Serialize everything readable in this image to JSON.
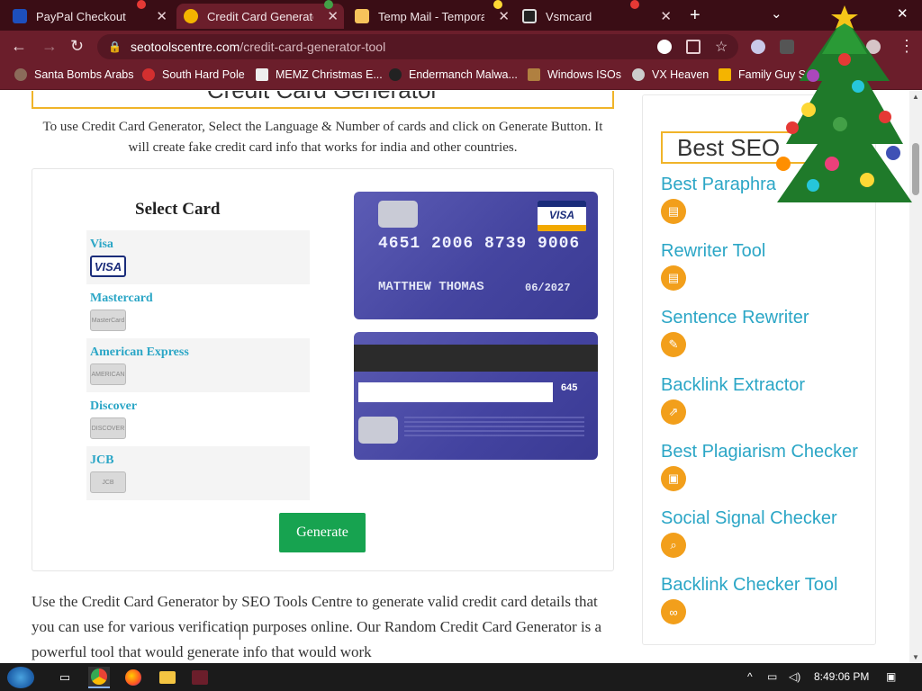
{
  "tabs": [
    {
      "label": "PayPal Checkout",
      "icon": "paypal-icon",
      "active": false
    },
    {
      "label": "Credit Card Generator",
      "icon": "seotools-icon",
      "active": true
    },
    {
      "label": "Temp Mail - Temporary",
      "icon": "mail-icon",
      "active": false
    },
    {
      "label": "Vsmcard",
      "icon": "card-icon",
      "active": false
    }
  ],
  "toolbar": {
    "url_domain": "seotoolscentre.com",
    "url_path": "/credit-card-generator-tool"
  },
  "bookmarks": [
    {
      "label": "Santa Bombs Arabs"
    },
    {
      "label": "South Hard Pole"
    },
    {
      "label": "MEMZ Christmas E..."
    },
    {
      "label": "Endermanch Malwa..."
    },
    {
      "label": "Windows ISOs"
    },
    {
      "label": "VX Heaven"
    },
    {
      "label": "Family Guy S..."
    }
  ],
  "main": {
    "heading": "Credit Card Generator",
    "intro": "To use Credit Card Generator, Select the Language & Number of cards and click on Generate Button. It will create fake credit card info that works for india and other countries.",
    "select_title": "Select Card",
    "card_options": [
      {
        "label": "Visa",
        "logo": "VISA"
      },
      {
        "label": "Mastercard",
        "logo": "MasterCard"
      },
      {
        "label": "American Express",
        "logo": "AMERICAN"
      },
      {
        "label": "Discover",
        "logo": "DISCOVER"
      },
      {
        "label": "JCB",
        "logo": "JCB"
      }
    ],
    "card_front": {
      "number": "4651 2006 8739 9006",
      "name": "MATTHEW THOMAS",
      "expiry": "06/2027",
      "brand": "VISA"
    },
    "card_back": {
      "cvv": "645"
    },
    "generate_label": "Generate",
    "description": "Use the Credit Card Generator by SEO Tools Centre to generate valid credit card details that you can use for various verification purposes online. Our Random Credit Card Generator is a powerful tool that would generate info that would work"
  },
  "sidebar": {
    "title": "Best SEO",
    "tools": [
      {
        "name": "Best Paraphra",
        "icon": "document-icon"
      },
      {
        "name": "Rewriter Tool",
        "icon": "document-icon"
      },
      {
        "name": "Sentence Rewriter",
        "icon": "edit-icon"
      },
      {
        "name": "Backlink Extractor",
        "icon": "link-icon"
      },
      {
        "name": "Best Plagiarism Checker",
        "icon": "clipboard-icon"
      },
      {
        "name": "Social Signal Checker",
        "icon": "magnifier-icon"
      },
      {
        "name": "Backlink Checker Tool",
        "icon": "chain-icon"
      }
    ]
  },
  "taskbar": {
    "clock": "8:49:06 PM"
  },
  "colors": {
    "browser_frame": "#6b1e2b",
    "tab_strip": "#3a0d15",
    "link_teal": "#2ba6c6",
    "accent_orange": "#f0b429",
    "generate_green": "#17a350",
    "card_blue": "#4545a0"
  }
}
